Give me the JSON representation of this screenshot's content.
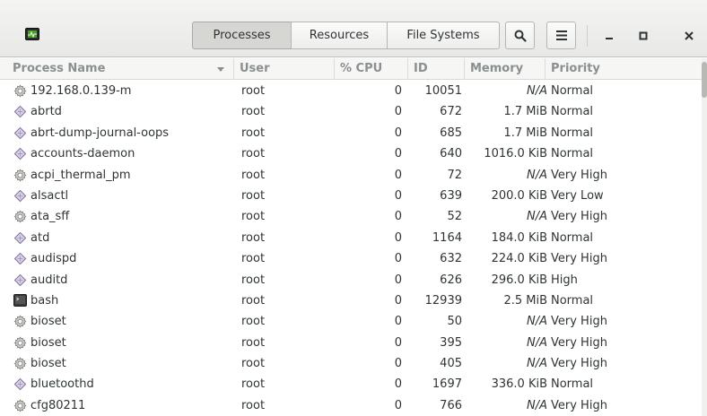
{
  "tabs": [
    {
      "label": "Processes",
      "active": true
    },
    {
      "label": "Resources",
      "active": false
    },
    {
      "label": "File Systems",
      "active": false
    }
  ],
  "columns": {
    "name": "Process Name",
    "user": "User",
    "cpu": "% CPU",
    "id": "ID",
    "memory": "Memory",
    "priority": "Priority"
  },
  "processes": [
    {
      "icon": "gear-icon",
      "name": "192.168.0.139-m",
      "user": "root",
      "cpu": "0",
      "id": "10051",
      "memory": "N/A",
      "priority": "Normal"
    },
    {
      "icon": "diamond-icon",
      "name": "abrtd",
      "user": "root",
      "cpu": "0",
      "id": "672",
      "memory": "1.7 MiB",
      "priority": "Normal"
    },
    {
      "icon": "diamond-icon",
      "name": "abrt-dump-journal-oops",
      "user": "root",
      "cpu": "0",
      "id": "685",
      "memory": "1.7 MiB",
      "priority": "Normal"
    },
    {
      "icon": "diamond-icon",
      "name": "accounts-daemon",
      "user": "root",
      "cpu": "0",
      "id": "640",
      "memory": "1016.0 KiB",
      "priority": "Normal"
    },
    {
      "icon": "gear-icon",
      "name": "acpi_thermal_pm",
      "user": "root",
      "cpu": "0",
      "id": "72",
      "memory": "N/A",
      "priority": "Very High"
    },
    {
      "icon": "diamond-icon",
      "name": "alsactl",
      "user": "root",
      "cpu": "0",
      "id": "639",
      "memory": "200.0 KiB",
      "priority": "Very Low"
    },
    {
      "icon": "gear-icon",
      "name": "ata_sff",
      "user": "root",
      "cpu": "0",
      "id": "52",
      "memory": "N/A",
      "priority": "Very High"
    },
    {
      "icon": "diamond-icon",
      "name": "atd",
      "user": "root",
      "cpu": "0",
      "id": "1164",
      "memory": "184.0 KiB",
      "priority": "Normal"
    },
    {
      "icon": "diamond-icon",
      "name": "audispd",
      "user": "root",
      "cpu": "0",
      "id": "632",
      "memory": "224.0 KiB",
      "priority": "Very High"
    },
    {
      "icon": "diamond-icon",
      "name": "auditd",
      "user": "root",
      "cpu": "0",
      "id": "626",
      "memory": "296.0 KiB",
      "priority": "High"
    },
    {
      "icon": "terminal-icon",
      "name": "bash",
      "user": "root",
      "cpu": "0",
      "id": "12939",
      "memory": "2.5 MiB",
      "priority": "Normal"
    },
    {
      "icon": "gear-icon",
      "name": "bioset",
      "user": "root",
      "cpu": "0",
      "id": "50",
      "memory": "N/A",
      "priority": "Very High"
    },
    {
      "icon": "gear-icon",
      "name": "bioset",
      "user": "root",
      "cpu": "0",
      "id": "395",
      "memory": "N/A",
      "priority": "Very High"
    },
    {
      "icon": "gear-icon",
      "name": "bioset",
      "user": "root",
      "cpu": "0",
      "id": "405",
      "memory": "N/A",
      "priority": "Very High"
    },
    {
      "icon": "diamond-icon",
      "name": "bluetoothd",
      "user": "root",
      "cpu": "0",
      "id": "1697",
      "memory": "336.0 KiB",
      "priority": "Normal"
    },
    {
      "icon": "gear-icon",
      "name": "cfg80211",
      "user": "root",
      "cpu": "0",
      "id": "766",
      "memory": "N/A",
      "priority": "Very High"
    }
  ]
}
